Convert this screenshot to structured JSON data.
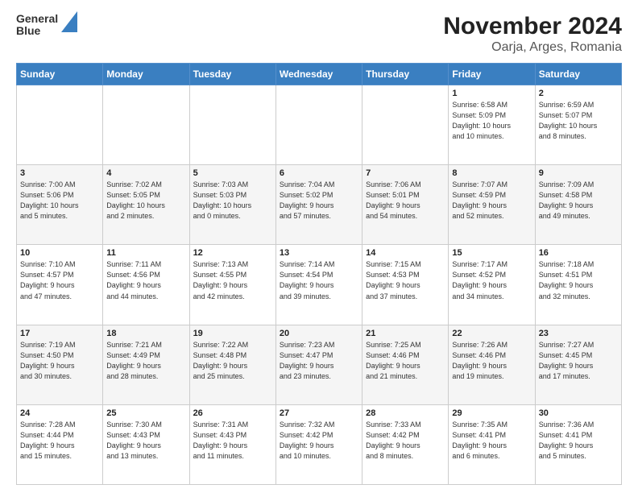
{
  "logo": {
    "line1": "General",
    "line2": "Blue"
  },
  "title": "November 2024",
  "subtitle": "Oarja, Arges, Romania",
  "header": {
    "days": [
      "Sunday",
      "Monday",
      "Tuesday",
      "Wednesday",
      "Thursday",
      "Friday",
      "Saturday"
    ]
  },
  "weeks": [
    {
      "cells": [
        {
          "day": "",
          "info": ""
        },
        {
          "day": "",
          "info": ""
        },
        {
          "day": "",
          "info": ""
        },
        {
          "day": "",
          "info": ""
        },
        {
          "day": "",
          "info": ""
        },
        {
          "day": "1",
          "info": "Sunrise: 6:58 AM\nSunset: 5:09 PM\nDaylight: 10 hours\nand 10 minutes."
        },
        {
          "day": "2",
          "info": "Sunrise: 6:59 AM\nSunset: 5:07 PM\nDaylight: 10 hours\nand 8 minutes."
        }
      ]
    },
    {
      "cells": [
        {
          "day": "3",
          "info": "Sunrise: 7:00 AM\nSunset: 5:06 PM\nDaylight: 10 hours\nand 5 minutes."
        },
        {
          "day": "4",
          "info": "Sunrise: 7:02 AM\nSunset: 5:05 PM\nDaylight: 10 hours\nand 2 minutes."
        },
        {
          "day": "5",
          "info": "Sunrise: 7:03 AM\nSunset: 5:03 PM\nDaylight: 10 hours\nand 0 minutes."
        },
        {
          "day": "6",
          "info": "Sunrise: 7:04 AM\nSunset: 5:02 PM\nDaylight: 9 hours\nand 57 minutes."
        },
        {
          "day": "7",
          "info": "Sunrise: 7:06 AM\nSunset: 5:01 PM\nDaylight: 9 hours\nand 54 minutes."
        },
        {
          "day": "8",
          "info": "Sunrise: 7:07 AM\nSunset: 4:59 PM\nDaylight: 9 hours\nand 52 minutes."
        },
        {
          "day": "9",
          "info": "Sunrise: 7:09 AM\nSunset: 4:58 PM\nDaylight: 9 hours\nand 49 minutes."
        }
      ]
    },
    {
      "cells": [
        {
          "day": "10",
          "info": "Sunrise: 7:10 AM\nSunset: 4:57 PM\nDaylight: 9 hours\nand 47 minutes."
        },
        {
          "day": "11",
          "info": "Sunrise: 7:11 AM\nSunset: 4:56 PM\nDaylight: 9 hours\nand 44 minutes."
        },
        {
          "day": "12",
          "info": "Sunrise: 7:13 AM\nSunset: 4:55 PM\nDaylight: 9 hours\nand 42 minutes."
        },
        {
          "day": "13",
          "info": "Sunrise: 7:14 AM\nSunset: 4:54 PM\nDaylight: 9 hours\nand 39 minutes."
        },
        {
          "day": "14",
          "info": "Sunrise: 7:15 AM\nSunset: 4:53 PM\nDaylight: 9 hours\nand 37 minutes."
        },
        {
          "day": "15",
          "info": "Sunrise: 7:17 AM\nSunset: 4:52 PM\nDaylight: 9 hours\nand 34 minutes."
        },
        {
          "day": "16",
          "info": "Sunrise: 7:18 AM\nSunset: 4:51 PM\nDaylight: 9 hours\nand 32 minutes."
        }
      ]
    },
    {
      "cells": [
        {
          "day": "17",
          "info": "Sunrise: 7:19 AM\nSunset: 4:50 PM\nDaylight: 9 hours\nand 30 minutes."
        },
        {
          "day": "18",
          "info": "Sunrise: 7:21 AM\nSunset: 4:49 PM\nDaylight: 9 hours\nand 28 minutes."
        },
        {
          "day": "19",
          "info": "Sunrise: 7:22 AM\nSunset: 4:48 PM\nDaylight: 9 hours\nand 25 minutes."
        },
        {
          "day": "20",
          "info": "Sunrise: 7:23 AM\nSunset: 4:47 PM\nDaylight: 9 hours\nand 23 minutes."
        },
        {
          "day": "21",
          "info": "Sunrise: 7:25 AM\nSunset: 4:46 PM\nDaylight: 9 hours\nand 21 minutes."
        },
        {
          "day": "22",
          "info": "Sunrise: 7:26 AM\nSunset: 4:46 PM\nDaylight: 9 hours\nand 19 minutes."
        },
        {
          "day": "23",
          "info": "Sunrise: 7:27 AM\nSunset: 4:45 PM\nDaylight: 9 hours\nand 17 minutes."
        }
      ]
    },
    {
      "cells": [
        {
          "day": "24",
          "info": "Sunrise: 7:28 AM\nSunset: 4:44 PM\nDaylight: 9 hours\nand 15 minutes."
        },
        {
          "day": "25",
          "info": "Sunrise: 7:30 AM\nSunset: 4:43 PM\nDaylight: 9 hours\nand 13 minutes."
        },
        {
          "day": "26",
          "info": "Sunrise: 7:31 AM\nSunset: 4:43 PM\nDaylight: 9 hours\nand 11 minutes."
        },
        {
          "day": "27",
          "info": "Sunrise: 7:32 AM\nSunset: 4:42 PM\nDaylight: 9 hours\nand 10 minutes."
        },
        {
          "day": "28",
          "info": "Sunrise: 7:33 AM\nSunset: 4:42 PM\nDaylight: 9 hours\nand 8 minutes."
        },
        {
          "day": "29",
          "info": "Sunrise: 7:35 AM\nSunset: 4:41 PM\nDaylight: 9 hours\nand 6 minutes."
        },
        {
          "day": "30",
          "info": "Sunrise: 7:36 AM\nSunset: 4:41 PM\nDaylight: 9 hours\nand 5 minutes."
        }
      ]
    }
  ]
}
